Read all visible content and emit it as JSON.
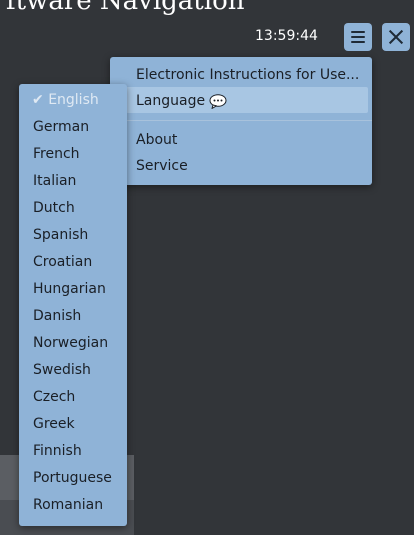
{
  "header": {
    "banner_text": "ftware Navigation",
    "clock": "13:59:44",
    "menu_icon": "hamburger-icon",
    "close_icon": "close-icon"
  },
  "main_menu": {
    "items": [
      {
        "label": "Electronic Instructions for Use..."
      },
      {
        "label": "Language",
        "icon": "chat-bubble-icon"
      },
      {
        "label": "About"
      },
      {
        "label": "Service"
      }
    ]
  },
  "language_menu": {
    "selected_marker": "✔",
    "items": [
      {
        "label": "English",
        "selected": true
      },
      {
        "label": "German"
      },
      {
        "label": "French"
      },
      {
        "label": "Italian"
      },
      {
        "label": "Dutch"
      },
      {
        "label": "Spanish"
      },
      {
        "label": "Croatian"
      },
      {
        "label": "Hungarian"
      },
      {
        "label": "Danish"
      },
      {
        "label": "Norwegian"
      },
      {
        "label": "Swedish"
      },
      {
        "label": "Czech"
      },
      {
        "label": "Greek"
      },
      {
        "label": "Finnish"
      },
      {
        "label": "Portuguese"
      },
      {
        "label": "Romanian"
      }
    ]
  },
  "colors": {
    "background": "#323539",
    "menu": "#8fb3d7",
    "highlight": "#a8c6e3"
  }
}
